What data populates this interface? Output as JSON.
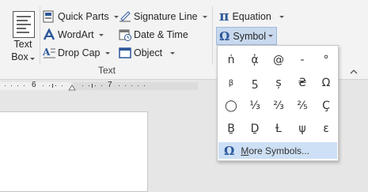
{
  "ribbon": {
    "text_box": {
      "line1": "Text",
      "line2": "Box"
    },
    "quick_parts": "Quick Parts",
    "wordart": "WordArt",
    "drop_cap": "Drop Cap",
    "signature_line": "Signature Line",
    "date_time": "Date & Time",
    "object": "Object",
    "group_label": "Text",
    "equation": "Equation",
    "equation_icon": "π",
    "symbol": "Symbol",
    "symbol_icon": "Ω"
  },
  "ruler": {
    "marks": [
      "6",
      "7"
    ]
  },
  "symbol_menu": {
    "symbols": [
      "ṅ",
      "ᾀ",
      "@",
      "-",
      "°",
      "β",
      "ƽ",
      "ș",
      "₴",
      "Ω",
      "◯",
      "⅓",
      "⅔",
      "⅖",
      "Ç",
      "Ḇ",
      "Ḏ",
      "Ɫ",
      "ψ",
      "ε"
    ],
    "more_icon": "Ω",
    "more_label_prefix": "M",
    "more_label_rest": "ore Symbols..."
  },
  "colors": {
    "accent": "#2b579a",
    "highlight": "#cde0f5",
    "selected_button": "#c8d9ee"
  },
  "icons": [
    "text-box-icon",
    "quick-parts-icon",
    "wordart-icon",
    "drop-cap-icon",
    "signature-line-icon",
    "date-time-icon",
    "object-icon",
    "equation-icon",
    "symbol-icon",
    "collapse-ribbon-icon"
  ]
}
